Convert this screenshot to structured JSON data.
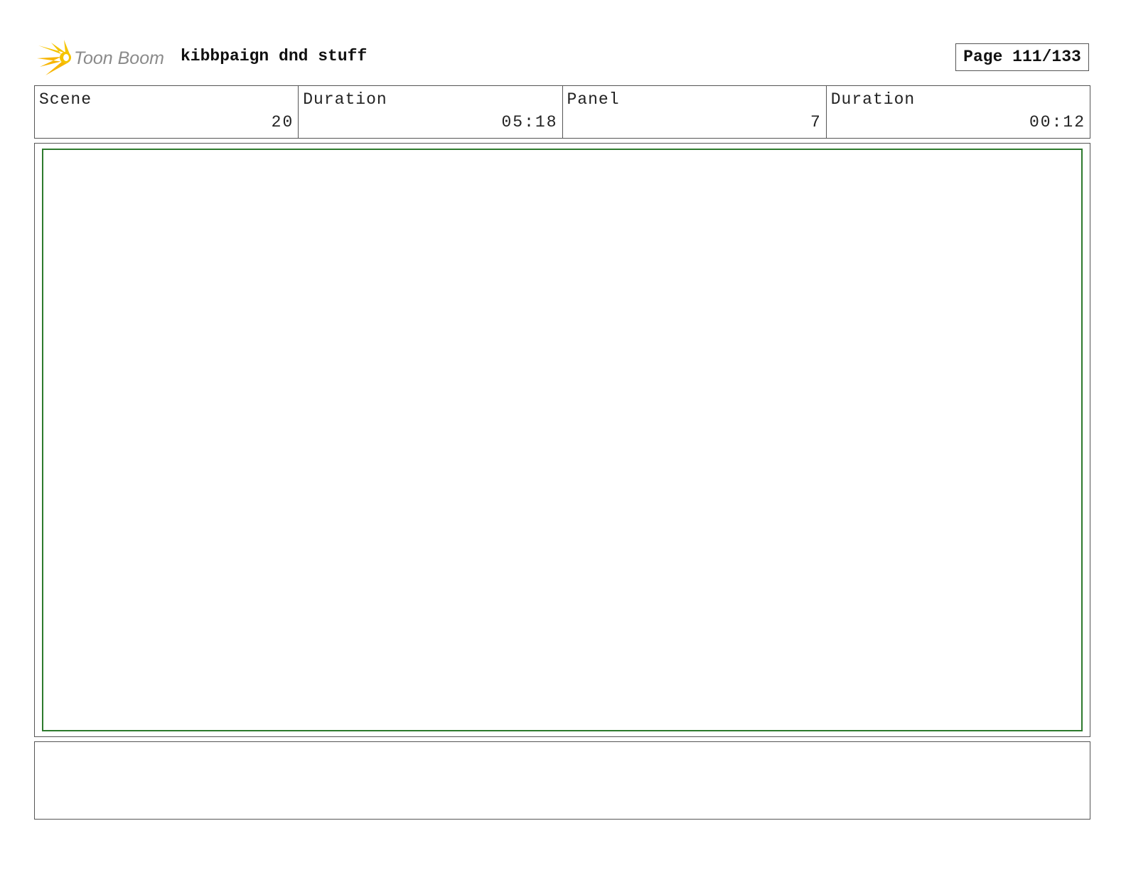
{
  "header": {
    "brand": "Toon Boom",
    "project_title": "kibbpaign dnd stuff",
    "page_indicator": "Page 111/133"
  },
  "info": {
    "scene_label": "Scene",
    "scene_value": "20",
    "scene_duration_label": "Duration",
    "scene_duration_value": "05:18",
    "panel_label": "Panel",
    "panel_value": "7",
    "panel_duration_label": "Duration",
    "panel_duration_value": "00:12"
  },
  "colors": {
    "logo_star": "#f5c400",
    "logo_text": "#8a8a8a",
    "panel_border": "#2d7a2d",
    "frame_border": "#555555"
  },
  "icons": {
    "logo": "toon-boom-star-logo"
  }
}
